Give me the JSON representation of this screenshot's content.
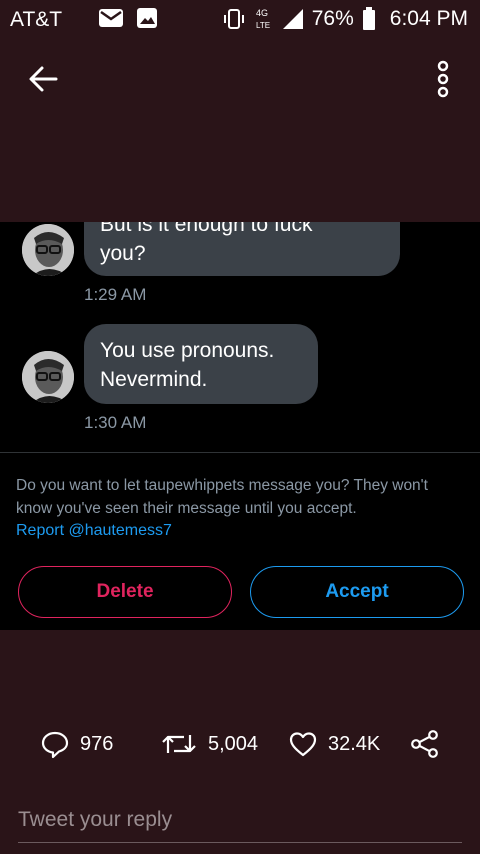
{
  "status_bar": {
    "carrier": "AT&T",
    "network": "4G LTE",
    "battery": "76%",
    "time": "6:04 PM"
  },
  "messages": [
    {
      "text_line1": "But is it enough to fuck",
      "text_line2": "you?",
      "time": "1:29 AM"
    },
    {
      "text_line1": "You use pronouns.",
      "text_line2": "Nevermind.",
      "time": "1:30 AM"
    }
  ],
  "request": {
    "prompt": "Do you want to let taupewhippets message you? They won't know you've seen their message until you accept.",
    "report_link": "Report @hautemess7",
    "delete_label": "Delete",
    "accept_label": "Accept"
  },
  "tweet_actions": {
    "replies": "976",
    "retweets": "5,004",
    "likes": "32.4K"
  },
  "reply_input": {
    "placeholder": "Tweet your reply"
  },
  "colors": {
    "background": "#2a1418",
    "panel": "#000000",
    "bubble": "#3b4148",
    "delete": "#e0245e",
    "accept": "#1d9bf0"
  }
}
